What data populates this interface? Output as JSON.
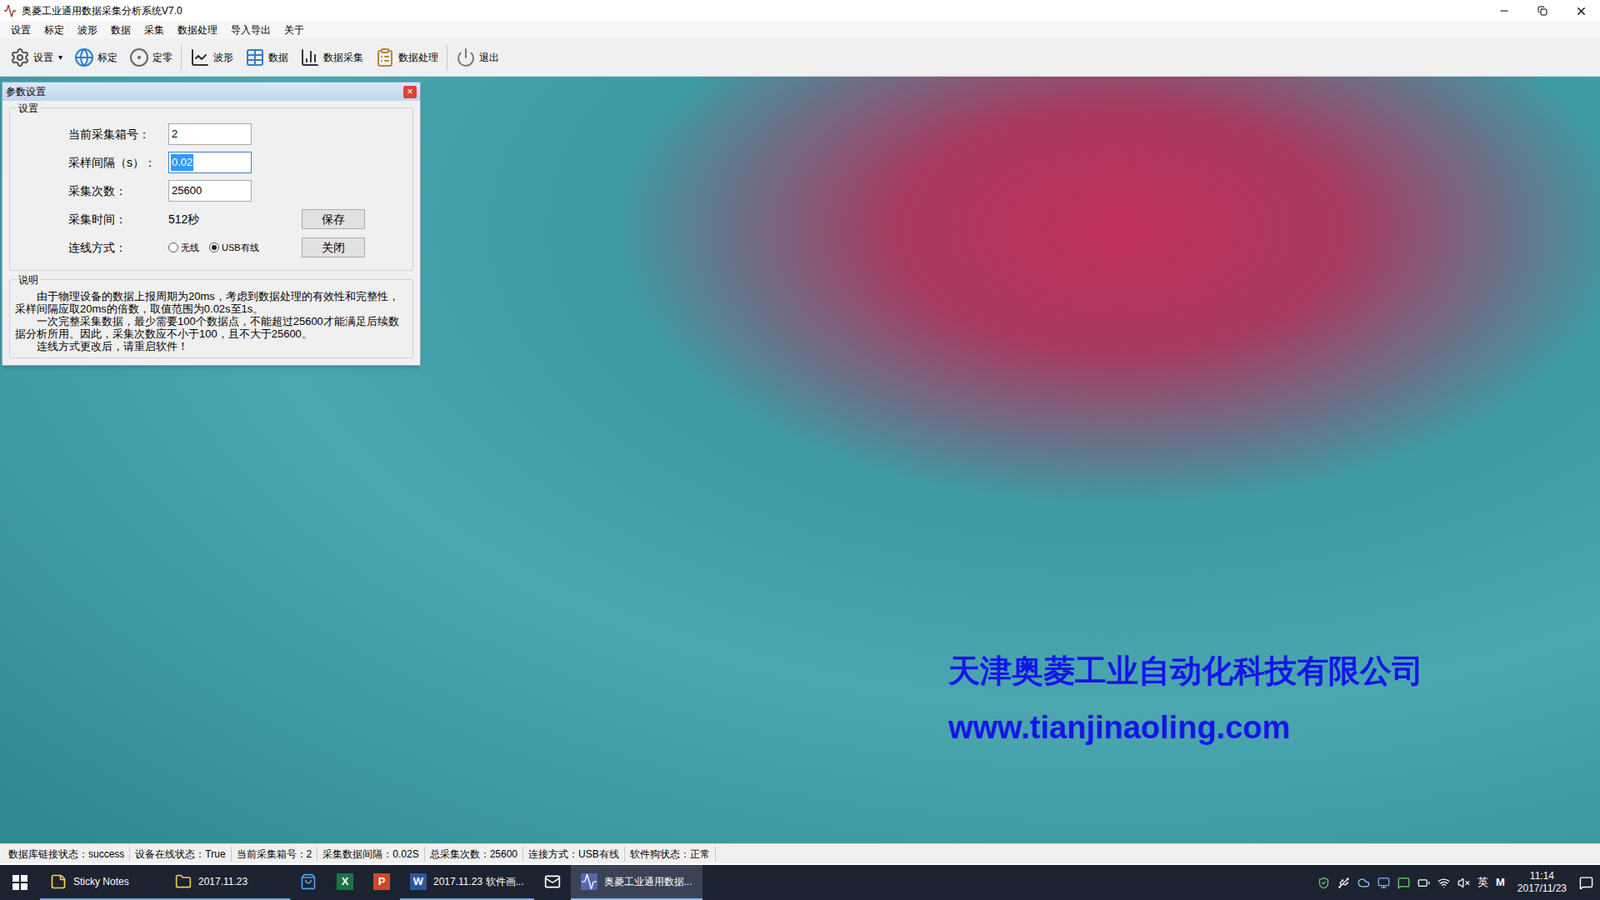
{
  "window": {
    "title": "奥菱工业通用数据采集分析系统V7.0"
  },
  "menu": [
    "设置",
    "标定",
    "波形",
    "数据",
    "采集",
    "数据处理",
    "导入导出",
    "关于"
  ],
  "toolbar": [
    {
      "label": "设置",
      "kind": "settings",
      "arrow": "▾"
    },
    {
      "label": "标定",
      "kind": "calibrate",
      "arrow": ""
    },
    {
      "label": "定零",
      "kind": "zero",
      "arrow": ""
    },
    {
      "label": "波形",
      "kind": "wave",
      "arrow": ""
    },
    {
      "label": "数据",
      "kind": "data",
      "arrow": ""
    },
    {
      "label": "数据采集",
      "kind": "collect",
      "arrow": ""
    },
    {
      "label": "数据处理",
      "kind": "process",
      "arrow": ""
    },
    {
      "label": "退出",
      "kind": "exit",
      "arrow": ""
    }
  ],
  "dialog": {
    "title": "参数设置",
    "close": "×",
    "group": "设置",
    "fields": [
      {
        "label": "当前采集箱号：",
        "value": "2",
        "selected": false
      },
      {
        "label": "采样间隔（s）：",
        "value": "0.02",
        "selected": true
      },
      {
        "label": "采集次数：",
        "value": "25600",
        "selected": false
      }
    ],
    "time": {
      "label": "采集时间：",
      "value": "512秒"
    },
    "connection": {
      "label": "连线方式：",
      "options": [
        {
          "label": "无线",
          "selected": false
        },
        {
          "label": "USB有线",
          "selected": true
        }
      ]
    },
    "buttons": [
      "保存",
      "关闭"
    ],
    "notes_title": "说明",
    "notes": [
      "由于物理设备的数据上报周期为20ms，考虑到数据处理的有效性和完整性，采样间隔应取20ms的倍数，取值范围为0.02s至1s。",
      "一次完整采集数据，最少需要100个数据点，不能超过25600才能满足后续数据分析所用。因此，采集次数应不小于100，且不大于25600。",
      "连线方式更改后，请重启软件！"
    ]
  },
  "brand": {
    "name": "天津奥菱工业自动化科技有限公司",
    "url": "www.tianjinaoling.com"
  },
  "status_bar": [
    "数据库链接状态：success",
    "设备在线状态：True",
    "当前采集箱号：2",
    "采集数据间隔：0.02S",
    "总采集次数：25600",
    "连接方式：USB有线",
    "软件狗状态：正常"
  ],
  "taskbar": {
    "items": [
      {
        "kind": "notes",
        "label": "Sticky Notes",
        "glyph": "",
        "open": true,
        "active": false
      },
      {
        "kind": "folder",
        "label": "2017.11.23",
        "glyph": "",
        "open": true,
        "active": false
      },
      {
        "kind": "store",
        "label": "",
        "glyph": "",
        "open": false,
        "active": false
      },
      {
        "kind": "excel",
        "label": "",
        "glyph": "X",
        "open": false,
        "active": false
      },
      {
        "kind": "ppt",
        "label": "",
        "glyph": "P",
        "open": false,
        "active": false
      },
      {
        "kind": "word",
        "label": "2017.11.23 软件画...",
        "glyph": "W",
        "open": true,
        "active": false
      },
      {
        "kind": "mail",
        "label": "",
        "glyph": "",
        "open": false,
        "active": false
      },
      {
        "kind": "app",
        "label": "奥菱工业通用数据...",
        "glyph": "",
        "open": true,
        "active": true
      }
    ],
    "tray": {
      "ime": "英",
      "m": "M",
      "time": "11:14",
      "date": "2017/11/23"
    }
  }
}
